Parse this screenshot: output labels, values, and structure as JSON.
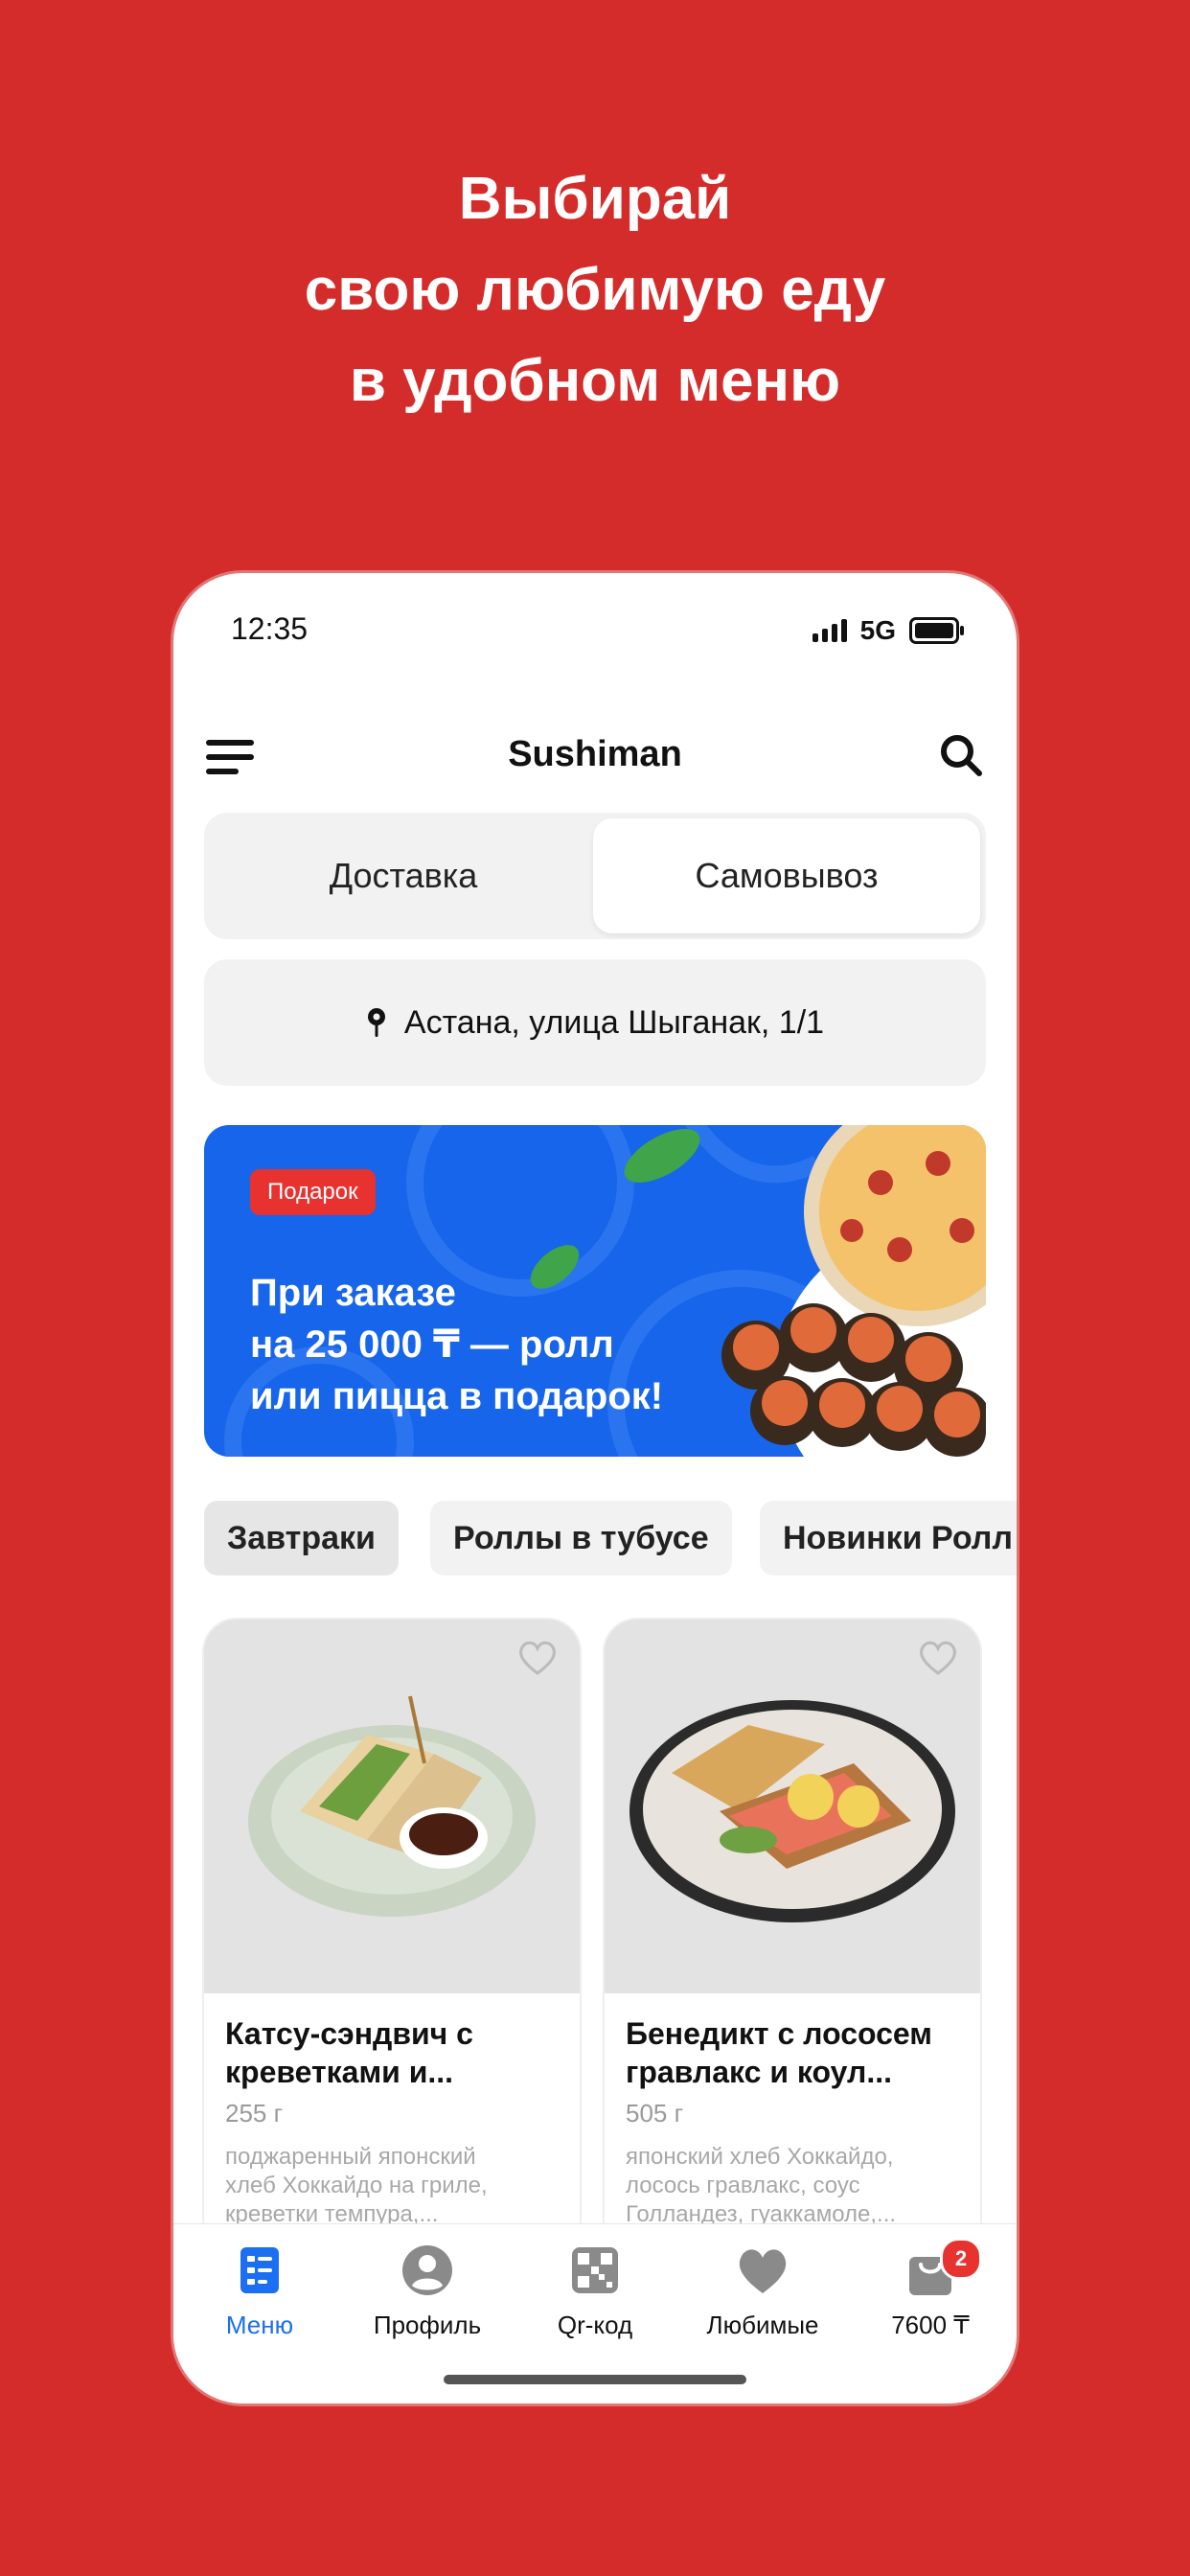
{
  "headline": [
    "Выбирай",
    "свою любимую еду",
    "в удобном меню"
  ],
  "status_bar": {
    "time": "12:35",
    "network": "5G"
  },
  "app_bar": {
    "title": "Sushiman"
  },
  "delivery_mode": {
    "options": [
      "Доставка",
      "Самовывоз"
    ],
    "selected": "Самовывоз"
  },
  "address": "Астана, улица Шыганак, 1/1",
  "banner": {
    "badge": "Подарок",
    "lines": [
      "При заказе",
      "на 25 000 ₸ — ролл",
      "или пицца в подарок!"
    ]
  },
  "categories": [
    "Завтраки",
    "Роллы в тубусе",
    "Новинки Ролл"
  ],
  "products": [
    {
      "name_lines": [
        "Катсу-сэндвич с",
        "креветками и..."
      ],
      "weight": "255 г",
      "desc_lines": [
        "поджаренный японский",
        "хлеб Хоккайдо на гриле,",
        "креветки темпура,..."
      ]
    },
    {
      "name_lines": [
        "Бенедикт с лососем",
        "гравлакс и коул..."
      ],
      "weight": "505 г",
      "desc_lines": [
        "японский хлеб Хоккайдо,",
        "лосось гравлакс, соус",
        "Голландез, гуаккамоле,..."
      ]
    }
  ],
  "tab_bar": {
    "tabs": [
      "Меню",
      "Профиль",
      "Qr-код",
      "Любимые",
      "7600 ₸"
    ],
    "active": "Меню",
    "cart_badge": "2"
  },
  "colors": {
    "brand_red": "#d42b2b",
    "accent_blue": "#1c6ef2",
    "banner_blue": "#1665ea"
  }
}
